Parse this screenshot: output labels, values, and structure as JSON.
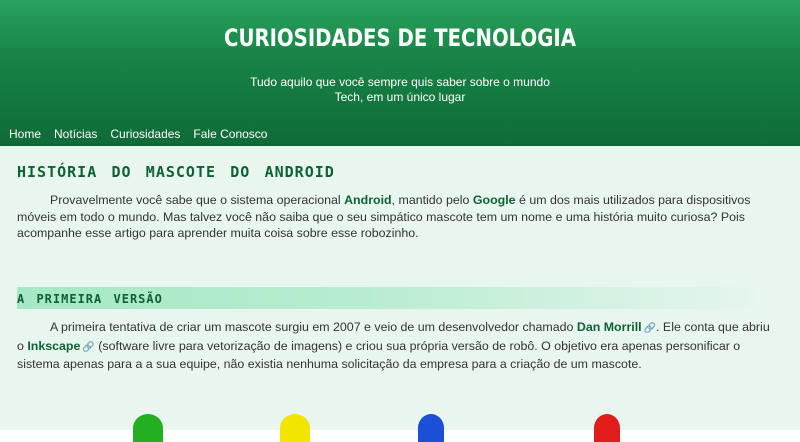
{
  "header": {
    "title": "CURIOSIDADES DE TECNOLOGIA",
    "tagline_line1": "Tudo aquilo que você sempre quis saber sobre o mundo",
    "tagline_line2": "Tech, em um único lugar"
  },
  "nav": [
    "Home",
    "Notícias",
    "Curiosidades",
    "Fale Conosco"
  ],
  "article": {
    "title": "História do Mascote do Android",
    "intro": {
      "t1": "Provavelmente você sabe que o sistema operacional ",
      "b1": "Android",
      "t2": ", mantido pelo ",
      "b2": "Google",
      "t3": " é um dos mais utilizados para dispositivos móveis em todo o mundo. Mas talvez você não saiba que o seu simpático mascote tem um nome e uma história muito curiosa? Pois acompanhe esse artigo para aprender muita coisa sobre esse robozinho."
    },
    "section_title": "A Primeira Versão",
    "section_para": {
      "t1": "A primeira tentativa de criar um mascote surgiu em 2007 e veio de um desenvolvedor chamado ",
      "b1": "Dan Morrill",
      "t2": ". Ele conta que abriu o ",
      "b2": "Inkscape",
      "t3": " (software livre para vetorização de imagens) e criou sua própria versão de robô. O objetivo era apenas personificar o sistema apenas para a a sua equipe, não existia nenhuma solicitação da empresa para a criação de um mascote."
    },
    "link_icon": "link-icon",
    "mascot_colors": [
      "#22b022",
      "#f2e600",
      "#1a4fd6",
      "#e21b1b"
    ]
  }
}
